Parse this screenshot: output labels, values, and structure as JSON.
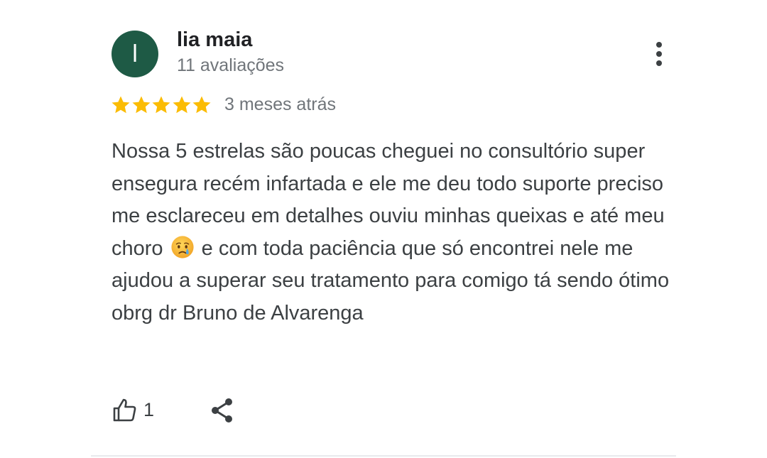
{
  "review": {
    "author": {
      "initial": "l",
      "name": "lia maia",
      "review_count": "11 avaliações",
      "avatar_color": "#1e5a45"
    },
    "rating": 5,
    "max_rating": 5,
    "star_color": "#fbbc04",
    "time_ago": "3 meses atrás",
    "text_part1": "Nossa 5 estrelas são poucas cheguei no consultório super ensegura recém infartada e ele me deu todo suporte preciso me esclareceu em detalhes ouviu minhas queixas e até meu choro",
    "emoji": "crying-face-icon",
    "text_part2": "e com toda paciência que só encontrei nele me ajudou a superar seu tratamento para comigo tá sendo ótimo obrg dr Bruno de Alvarenga",
    "likes": "1",
    "actions": {
      "more": "more-vert-icon",
      "like": "thumb-up-icon",
      "share": "share-icon"
    }
  }
}
